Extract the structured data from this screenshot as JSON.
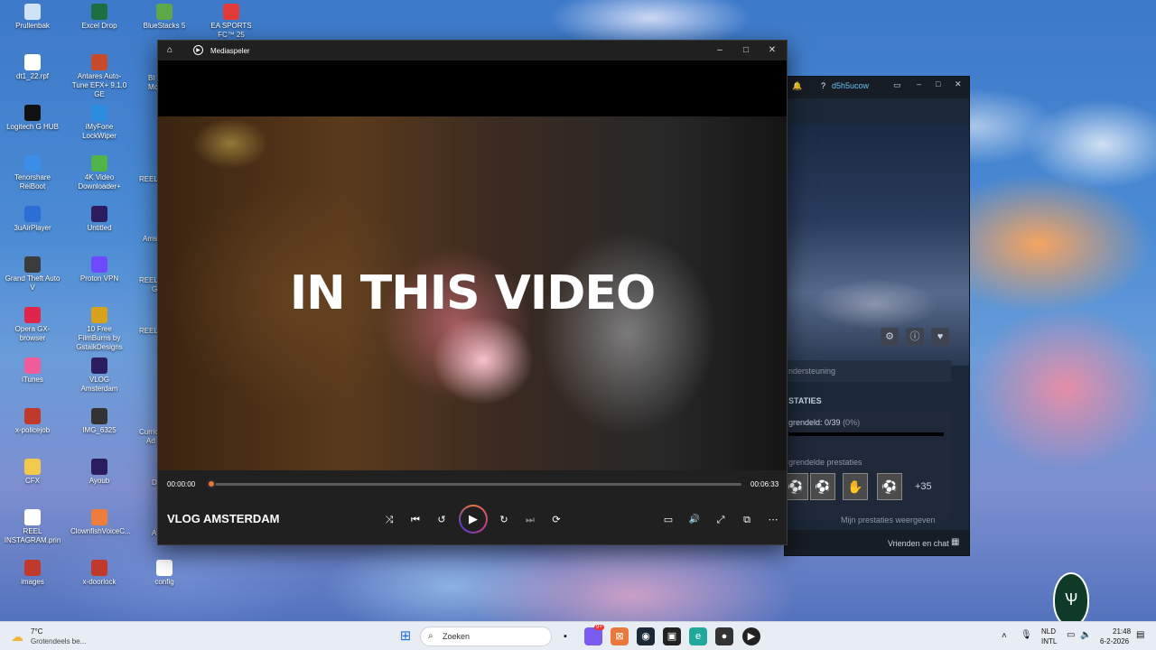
{
  "desktop": {
    "icons": [
      {
        "label": "Prullenbak",
        "color": "#cfe3f7"
      },
      {
        "label": "Excel Drop",
        "color": "#1d6f42"
      },
      {
        "label": "BlueStacks 5",
        "color": "#5fa84a"
      },
      {
        "label": "EA SPORTS FC™ 25",
        "color": "#e33a3a"
      },
      {
        "label": "dt1_22.rpf",
        "color": "#ffffff"
      },
      {
        "label": "Antares Auto-Tune EFX+ 9.1.0 GE",
        "color": "#c74b2b"
      },
      {
        "label": "Logitech G HUB",
        "color": "#111111"
      },
      {
        "label": "iMyFone LockWiper",
        "color": "#2b8be0"
      },
      {
        "label": "Tenorshare ReiBoot",
        "color": "#3a8ee8"
      },
      {
        "label": "4K Video Downloader+",
        "color": "#4fb548"
      },
      {
        "label": "3uAirPlayer",
        "color": "#2b6fd6"
      },
      {
        "label": "Untitled",
        "color": "#2a1c5e"
      },
      {
        "label": "Grand Theft Auto V",
        "color": "#3c3c3c"
      },
      {
        "label": "Proton VPN",
        "color": "#6d4aff"
      },
      {
        "label": "Opera GX-browser",
        "color": "#e0244a"
      },
      {
        "label": "10 Free FilmBurns by GstaikDesigns",
        "color": "#d8a21c"
      },
      {
        "label": "iTunes",
        "color": "#f25b9a"
      },
      {
        "label": "VLOG Amsterdam",
        "color": "#2a1c5e"
      },
      {
        "label": "x-policejob",
        "color": "#c0392b"
      },
      {
        "label": "IMG_6325",
        "color": "#333333"
      },
      {
        "label": "CFX",
        "color": "#f2c94c"
      },
      {
        "label": "Ayoub",
        "color": "#2a1c5e"
      },
      {
        "label": "REEL INSTAGRAM.prin",
        "color": "#ffffff"
      },
      {
        "label": "ClownfishVoiceC...",
        "color": "#f07c3c"
      },
      {
        "label": "images",
        "color": "#c0392b"
      },
      {
        "label": "x-doorlock",
        "color": "#c0392b"
      },
      {
        "label": "config",
        "color": "#ffffff"
      }
    ],
    "partial_labels": [
      "Bl",
      "Mo",
      "REEL",
      "REEL",
      "G",
      "REEL",
      "Ams",
      "Curric",
      "Ad",
      "D",
      "A"
    ]
  },
  "player": {
    "app_title": "Mediaspeler",
    "caption": "IN THIS VIDEO",
    "time_current": "00:00:00",
    "time_total": "00:06:33",
    "progress": 0.0,
    "video_title": "VLOG AMSTERDAM",
    "controls": {
      "shuffle": "⤨",
      "previous": "⏮",
      "rewind": "↺",
      "play": "▶",
      "forward": "↻",
      "next": "⏭",
      "repeat": "⟳",
      "subtitles": "▭",
      "volume": "🔊",
      "fullscreen": "⤢",
      "miniplayer": "⧉",
      "more": "⋯"
    },
    "rewind_label": "10",
    "forward_label": "30"
  },
  "steam": {
    "username": "d5h5ucow",
    "help": "?",
    "support_text": "ndersteuning",
    "achievements_header": "STATIES",
    "unlocked_text": "grendeld: 0/39",
    "unlocked_pct": "(0%)",
    "progress": 0.0,
    "locked_text": "grendelde prestaties",
    "more_count": "+35",
    "view_link": "Mijn prestaties weergeven",
    "friends_chat": "Vrienden en chat"
  },
  "taskbar": {
    "weather_temp": "7°C",
    "weather_desc": "Grotendeels be...",
    "search_placeholder": "Zoeken",
    "lang_top": "NLD",
    "lang_bottom": "INTL",
    "clock_time": "21:48",
    "clock_date": "6-2-2026",
    "chat_badge": "9+"
  }
}
